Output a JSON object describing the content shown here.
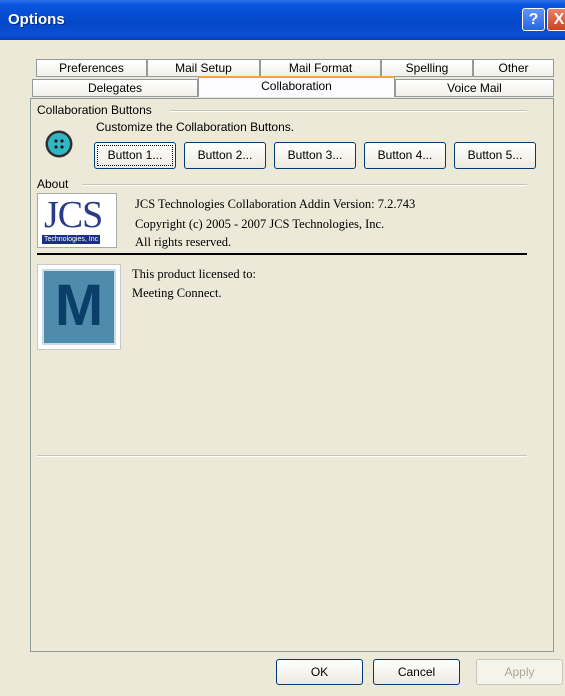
{
  "window": {
    "title": "Options",
    "help_glyph": "?",
    "close_glyph": "X"
  },
  "tabs_row1": [
    "Preferences",
    "Mail Setup",
    "Mail Format",
    "Spelling",
    "Other"
  ],
  "tabs_row2": [
    "Delegates",
    "Collaboration",
    "Voice Mail"
  ],
  "active_tab": "Collaboration",
  "collab": {
    "group_label": "Collaboration Buttons",
    "instruction": "Customize the Collaboration Buttons.",
    "buttons": [
      "Button 1...",
      "Button 2...",
      "Button 3...",
      "Button 4...",
      "Button 5..."
    ],
    "icon": "collaboration-button-icon",
    "icon_color": "#33b6c4"
  },
  "about": {
    "group_label": "About",
    "logo_text": "JCS",
    "logo_subtext": "Technologies, Inc",
    "version_line": "JCS Technologies Collaboration Addin Version: 7.2.743",
    "copyright_line": "Copyright (c) 2005 - 2007 JCS Technologies, Inc.",
    "rights_line": "All rights reserved.",
    "license_label": "This product licensed to:",
    "licensee": "Meeting Connect.",
    "licensee_logo_letter": "M",
    "licensee_logo_color": "#4f8baa"
  },
  "footer": {
    "ok": "OK",
    "cancel": "Cancel",
    "apply": "Apply"
  }
}
